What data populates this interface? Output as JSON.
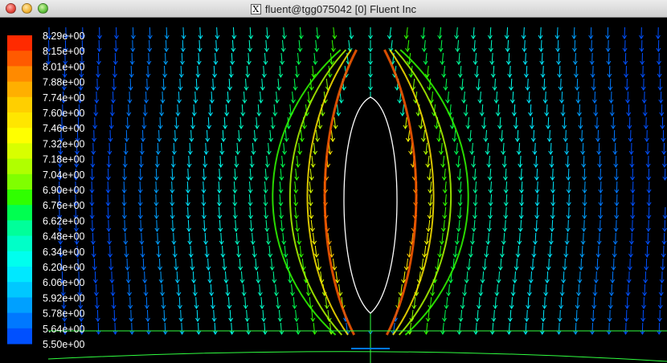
{
  "window": {
    "title": "fluent@tgg075042 [0] Fluent Inc",
    "title_icon": "x11-icon",
    "buttons": [
      "close",
      "minimize",
      "zoom"
    ]
  },
  "colormap": {
    "labels": [
      "8.29e+00",
      "8.15e+00",
      "8.01e+00",
      "7.88e+00",
      "7.74e+00",
      "7.60e+00",
      "7.46e+00",
      "7.32e+00",
      "7.18e+00",
      "7.04e+00",
      "6.90e+00",
      "6.76e+00",
      "6.62e+00",
      "6.48e+00",
      "6.34e+00",
      "6.20e+00",
      "6.06e+00",
      "5.92e+00",
      "5.78e+00",
      "5.64e+00",
      "5.50e+00"
    ],
    "colors": [
      "#ff2a00",
      "#ff5a00",
      "#ff8a00",
      "#ffaf00",
      "#ffcf00",
      "#ffe600",
      "#ffff00",
      "#d8ff00",
      "#b0ff00",
      "#80ff00",
      "#30ff00",
      "#00ff50",
      "#00ff9a",
      "#00ffc8",
      "#00ffee",
      "#00e8ff",
      "#00c8ff",
      "#00a0ff",
      "#0078ff",
      "#0050ff"
    ]
  },
  "plot": {
    "background": "#000000",
    "body_outline": "#ffffff",
    "grid_line": "#30ff40"
  }
}
